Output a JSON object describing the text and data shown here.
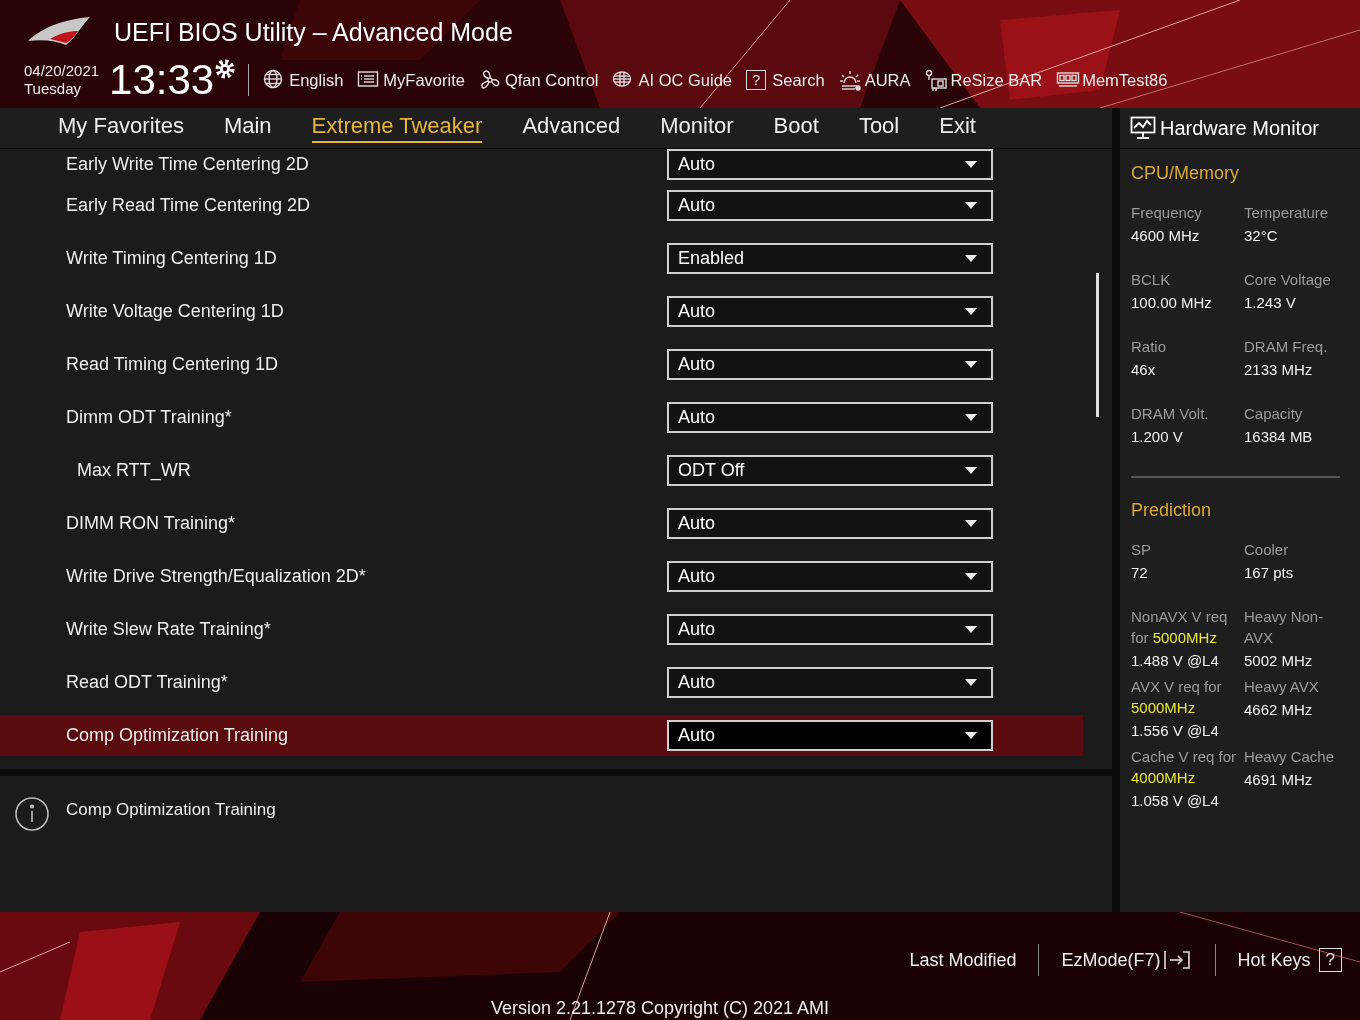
{
  "header": {
    "title": "UEFI BIOS Utility – Advanced Mode",
    "date": "04/20/2021",
    "day": "Tuesday",
    "time": "13:33",
    "toolbar": [
      {
        "label": "English"
      },
      {
        "label": "MyFavorite"
      },
      {
        "label": "Qfan Control"
      },
      {
        "label": "AI OC Guide"
      },
      {
        "label": "Search",
        "key": "?"
      },
      {
        "label": "AURA"
      },
      {
        "label": "ReSize BAR"
      },
      {
        "label": "MemTest86"
      }
    ]
  },
  "tabs": [
    {
      "label": "My Favorites",
      "selected": false
    },
    {
      "label": "Main",
      "selected": false
    },
    {
      "label": "Extreme Tweaker",
      "selected": true
    },
    {
      "label": "Advanced",
      "selected": false
    },
    {
      "label": "Monitor",
      "selected": false
    },
    {
      "label": "Boot",
      "selected": false
    },
    {
      "label": "Tool",
      "selected": false
    },
    {
      "label": "Exit",
      "selected": false
    }
  ],
  "settings": [
    {
      "label": "Early Write Time Centering 2D",
      "value": "Auto",
      "selected": false
    },
    {
      "label": "Early Read Time Centering 2D",
      "value": "Auto",
      "selected": false
    },
    {
      "label": "Write Timing Centering 1D",
      "value": "Enabled",
      "selected": false
    },
    {
      "label": "Write Voltage Centering 1D",
      "value": "Auto",
      "selected": false
    },
    {
      "label": "Read Timing Centering 1D",
      "value": "Auto",
      "selected": false
    },
    {
      "label": "Dimm ODT Training*",
      "value": "Auto",
      "selected": false,
      "children": [
        {
          "label": "Max RTT_WR",
          "value": "ODT Off",
          "selected": false
        }
      ]
    },
    {
      "label": "DIMM RON Training*",
      "value": "Auto",
      "selected": false
    },
    {
      "label": "Write Drive Strength/Equalization 2D*",
      "value": "Auto",
      "selected": false
    },
    {
      "label": "Write Slew Rate Training*",
      "value": "Auto",
      "selected": false
    },
    {
      "label": "Read ODT Training*",
      "value": "Auto",
      "selected": false
    },
    {
      "label": "Comp Optimization Training",
      "value": "Auto",
      "selected": true
    }
  ],
  "help": {
    "text": "Comp Optimization Training"
  },
  "hardware_monitor": {
    "title": "Hardware Monitor",
    "sections": [
      {
        "title": "CPU/Memory",
        "items": [
          {
            "label": "Frequency",
            "value": "4600 MHz"
          },
          {
            "label": "Temperature",
            "value": "32°C"
          },
          {
            "label": "BCLK",
            "value": "100.00 MHz"
          },
          {
            "label": "Core Voltage",
            "value": "1.243 V"
          },
          {
            "label": "Ratio",
            "value": "46x"
          },
          {
            "label": "DRAM Freq.",
            "value": "2133 MHz"
          },
          {
            "label": "DRAM Volt.",
            "value": "1.200 V"
          },
          {
            "label": "Capacity",
            "value": "16384 MB"
          }
        ]
      },
      {
        "title": "Prediction",
        "items": [
          {
            "label": "SP",
            "value": "72"
          },
          {
            "label": "Cooler",
            "value": "167 pts"
          },
          {
            "label": "NonAVX V req for",
            "highlight": "5000MHz",
            "value": "1.488 V @L4"
          },
          {
            "label": "Heavy Non-AVX",
            "value": "5002 MHz"
          },
          {
            "label": "AVX V req for",
            "highlight": "5000MHz",
            "value": "1.556 V @L4"
          },
          {
            "label": "Heavy AVX",
            "value": "4662 MHz"
          },
          {
            "label": "Cache V req for",
            "highlight": "4000MHz",
            "value": "1.058 V @L4"
          },
          {
            "label": "Heavy Cache",
            "value": "4691 MHz"
          }
        ]
      }
    ]
  },
  "footer": {
    "actions": [
      {
        "label": "Last Modified"
      },
      {
        "label": "EzMode(F7)"
      },
      {
        "label": "Hot Keys",
        "key": "?"
      }
    ],
    "version": "Version 2.21.1278 Copyright (C) 2021 AMI"
  }
}
